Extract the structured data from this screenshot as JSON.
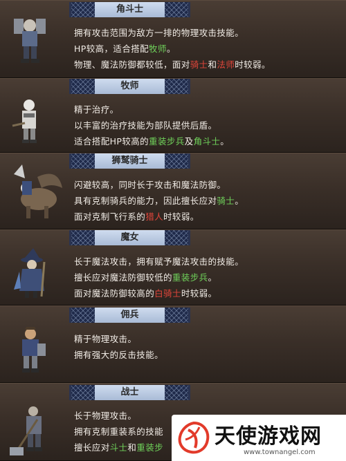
{
  "units": [
    {
      "title": "角斗士",
      "lines": [
        [
          {
            "t": "拥有攻击范围为敌方一排的物理攻击技能。"
          }
        ],
        [
          {
            "t": "HP较高，适合搭配"
          },
          {
            "t": "牧师",
            "c": "green"
          },
          {
            "t": "。"
          }
        ],
        [
          {
            "t": "物理、魔法防御都较低，面对"
          },
          {
            "t": "骑士",
            "c": "red"
          },
          {
            "t": "和"
          },
          {
            "t": "法师",
            "c": "red"
          },
          {
            "t": "时较弱。"
          }
        ]
      ]
    },
    {
      "title": "牧师",
      "lines": [
        [
          {
            "t": "精于治疗。"
          }
        ],
        [
          {
            "t": "以丰富的治疗技能为部队提供后盾。"
          }
        ],
        [
          {
            "t": "适合搭配HP较高的"
          },
          {
            "t": "重装步兵",
            "c": "green"
          },
          {
            "t": "及"
          },
          {
            "t": "角斗士",
            "c": "green"
          },
          {
            "t": "。"
          }
        ]
      ]
    },
    {
      "title": "狮鹫骑士",
      "lines": [
        [
          {
            "t": "闪避较高，同时长于攻击和魔法防御。"
          }
        ],
        [
          {
            "t": "具有克制骑兵的能力，因此擅长应对"
          },
          {
            "t": "骑士",
            "c": "green"
          },
          {
            "t": "。"
          }
        ],
        [
          {
            "t": "面对克制飞行系的"
          },
          {
            "t": "猎人",
            "c": "red"
          },
          {
            "t": "时较弱。"
          }
        ]
      ]
    },
    {
      "title": "魔女",
      "lines": [
        [
          {
            "t": "长于魔法攻击，拥有赋予魔法攻击的技能。"
          }
        ],
        [
          {
            "t": "擅长应对魔法防御较低的"
          },
          {
            "t": "重装步兵",
            "c": "green"
          },
          {
            "t": "。"
          }
        ],
        [
          {
            "t": "面对魔法防御较高的"
          },
          {
            "t": "白骑士",
            "c": "red"
          },
          {
            "t": "时较弱。"
          }
        ]
      ]
    },
    {
      "title": "佣兵",
      "lines": [
        [
          {
            "t": "精于物理攻击。"
          }
        ],
        [
          {
            "t": "拥有强大的反击技能。"
          }
        ]
      ]
    },
    {
      "title": "战士",
      "lines": [
        [
          {
            "t": "长于物理攻击。"
          }
        ],
        [
          {
            "t": "拥有克制重装系的技能"
          }
        ],
        [
          {
            "t": "擅长应对"
          },
          {
            "t": "斗士",
            "c": "green"
          },
          {
            "t": "和"
          },
          {
            "t": "重装步",
            "c": "green"
          }
        ]
      ]
    }
  ],
  "watermark": {
    "title": "天使游戏网",
    "url": "www.townangel.com"
  },
  "colors": {
    "highlight_red": "#e0453a",
    "highlight_green": "#6fd15a",
    "banner": "#b8c8e0"
  }
}
